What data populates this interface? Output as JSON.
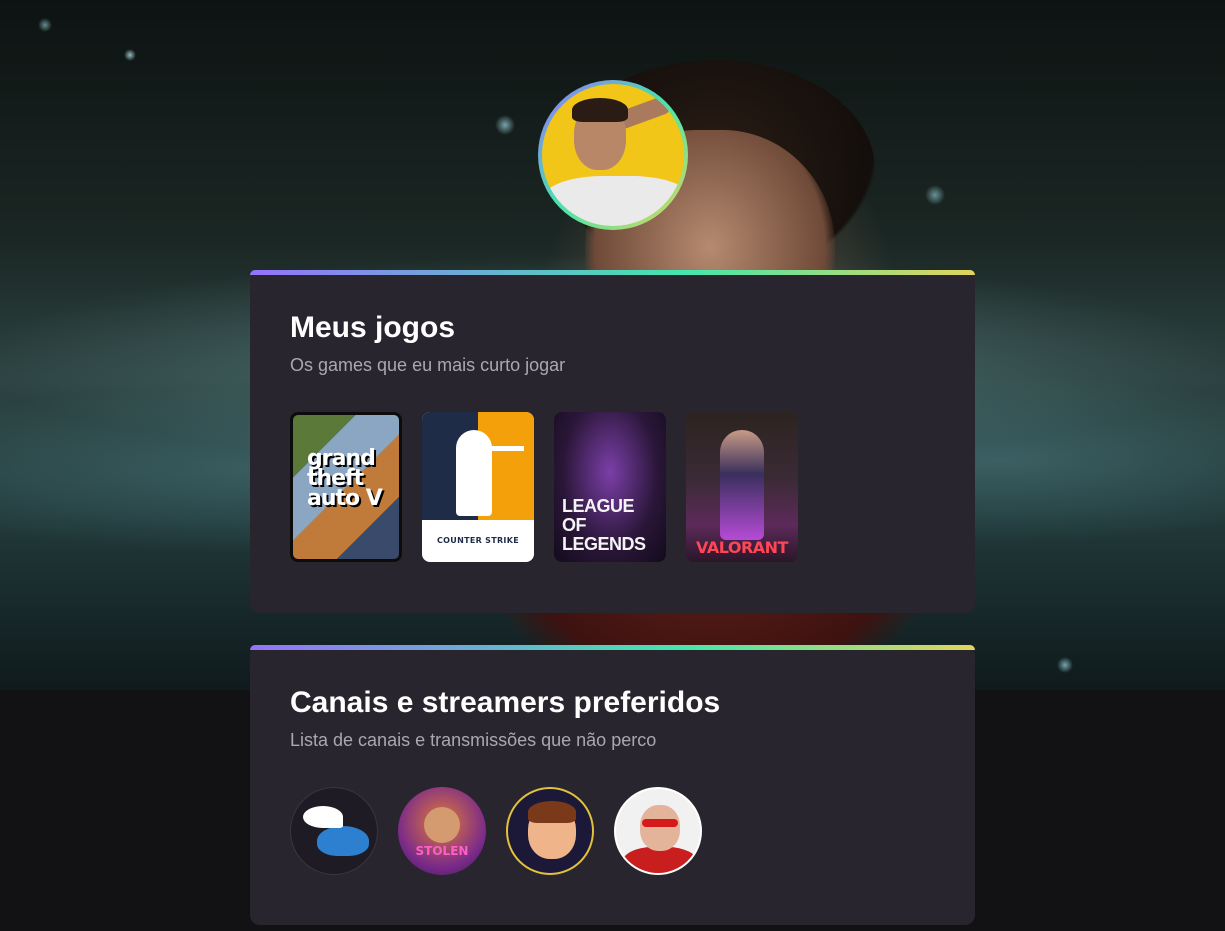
{
  "profile": {
    "avatar_alt": "Foto de perfil"
  },
  "games_section": {
    "title": "Meus jogos",
    "subtitle": "Os games que eu mais curto jogar",
    "games": [
      {
        "name": "GTA V",
        "logo_text": "grand theft auto V"
      },
      {
        "name": "Counter-Strike",
        "logo_text": "COUNTER STRIKE"
      },
      {
        "name": "League of Legends",
        "logo_text": "LEAGUE OF LEGENDS"
      },
      {
        "name": "Valorant",
        "logo_text": "VALORANT"
      }
    ]
  },
  "channels_section": {
    "title": "Canais e streamers preferidos",
    "subtitle": "Lista de canais e transmissões que não perco",
    "channels": [
      {
        "icon": "winged-hat-icon"
      },
      {
        "icon": "streamer-avatar-stolen",
        "label": "STOLEN"
      },
      {
        "icon": "streamer-avatar-cartoon"
      },
      {
        "icon": "streamer-avatar-red-glasses"
      }
    ]
  },
  "colors": {
    "card_bg": "#29252f",
    "page_bg": "#121214",
    "gradient": [
      "#9572fc",
      "#43e7ad",
      "#e2d45c"
    ],
    "subtitle": "#a8a8b3"
  }
}
